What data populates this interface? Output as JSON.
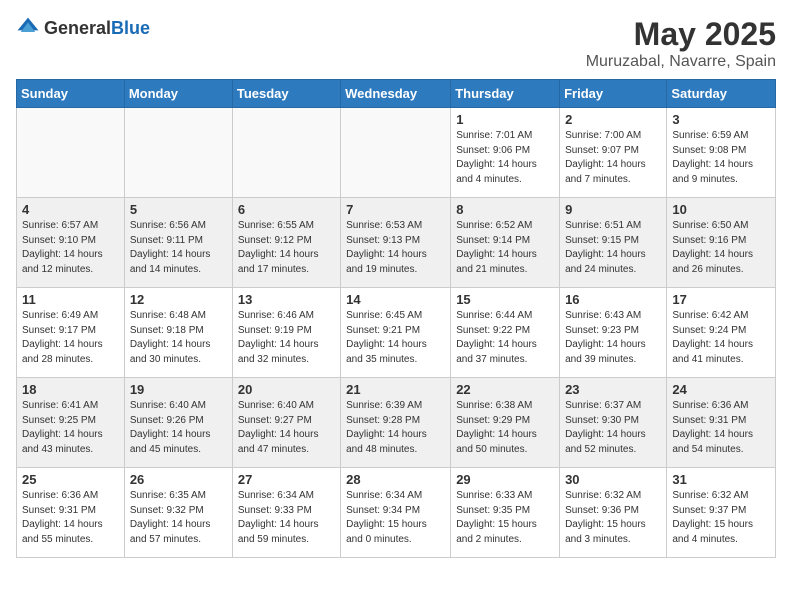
{
  "logo": {
    "general": "General",
    "blue": "Blue"
  },
  "title": "May 2025",
  "location": "Muruzabal, Navarre, Spain",
  "days_of_week": [
    "Sunday",
    "Monday",
    "Tuesday",
    "Wednesday",
    "Thursday",
    "Friday",
    "Saturday"
  ],
  "weeks": [
    [
      {
        "day": "",
        "info": ""
      },
      {
        "day": "",
        "info": ""
      },
      {
        "day": "",
        "info": ""
      },
      {
        "day": "",
        "info": ""
      },
      {
        "day": "1",
        "info": "Sunrise: 7:01 AM\nSunset: 9:06 PM\nDaylight: 14 hours\nand 4 minutes."
      },
      {
        "day": "2",
        "info": "Sunrise: 7:00 AM\nSunset: 9:07 PM\nDaylight: 14 hours\nand 7 minutes."
      },
      {
        "day": "3",
        "info": "Sunrise: 6:59 AM\nSunset: 9:08 PM\nDaylight: 14 hours\nand 9 minutes."
      }
    ],
    [
      {
        "day": "4",
        "info": "Sunrise: 6:57 AM\nSunset: 9:10 PM\nDaylight: 14 hours\nand 12 minutes."
      },
      {
        "day": "5",
        "info": "Sunrise: 6:56 AM\nSunset: 9:11 PM\nDaylight: 14 hours\nand 14 minutes."
      },
      {
        "day": "6",
        "info": "Sunrise: 6:55 AM\nSunset: 9:12 PM\nDaylight: 14 hours\nand 17 minutes."
      },
      {
        "day": "7",
        "info": "Sunrise: 6:53 AM\nSunset: 9:13 PM\nDaylight: 14 hours\nand 19 minutes."
      },
      {
        "day": "8",
        "info": "Sunrise: 6:52 AM\nSunset: 9:14 PM\nDaylight: 14 hours\nand 21 minutes."
      },
      {
        "day": "9",
        "info": "Sunrise: 6:51 AM\nSunset: 9:15 PM\nDaylight: 14 hours\nand 24 minutes."
      },
      {
        "day": "10",
        "info": "Sunrise: 6:50 AM\nSunset: 9:16 PM\nDaylight: 14 hours\nand 26 minutes."
      }
    ],
    [
      {
        "day": "11",
        "info": "Sunrise: 6:49 AM\nSunset: 9:17 PM\nDaylight: 14 hours\nand 28 minutes."
      },
      {
        "day": "12",
        "info": "Sunrise: 6:48 AM\nSunset: 9:18 PM\nDaylight: 14 hours\nand 30 minutes."
      },
      {
        "day": "13",
        "info": "Sunrise: 6:46 AM\nSunset: 9:19 PM\nDaylight: 14 hours\nand 32 minutes."
      },
      {
        "day": "14",
        "info": "Sunrise: 6:45 AM\nSunset: 9:21 PM\nDaylight: 14 hours\nand 35 minutes."
      },
      {
        "day": "15",
        "info": "Sunrise: 6:44 AM\nSunset: 9:22 PM\nDaylight: 14 hours\nand 37 minutes."
      },
      {
        "day": "16",
        "info": "Sunrise: 6:43 AM\nSunset: 9:23 PM\nDaylight: 14 hours\nand 39 minutes."
      },
      {
        "day": "17",
        "info": "Sunrise: 6:42 AM\nSunset: 9:24 PM\nDaylight: 14 hours\nand 41 minutes."
      }
    ],
    [
      {
        "day": "18",
        "info": "Sunrise: 6:41 AM\nSunset: 9:25 PM\nDaylight: 14 hours\nand 43 minutes."
      },
      {
        "day": "19",
        "info": "Sunrise: 6:40 AM\nSunset: 9:26 PM\nDaylight: 14 hours\nand 45 minutes."
      },
      {
        "day": "20",
        "info": "Sunrise: 6:40 AM\nSunset: 9:27 PM\nDaylight: 14 hours\nand 47 minutes."
      },
      {
        "day": "21",
        "info": "Sunrise: 6:39 AM\nSunset: 9:28 PM\nDaylight: 14 hours\nand 48 minutes."
      },
      {
        "day": "22",
        "info": "Sunrise: 6:38 AM\nSunset: 9:29 PM\nDaylight: 14 hours\nand 50 minutes."
      },
      {
        "day": "23",
        "info": "Sunrise: 6:37 AM\nSunset: 9:30 PM\nDaylight: 14 hours\nand 52 minutes."
      },
      {
        "day": "24",
        "info": "Sunrise: 6:36 AM\nSunset: 9:31 PM\nDaylight: 14 hours\nand 54 minutes."
      }
    ],
    [
      {
        "day": "25",
        "info": "Sunrise: 6:36 AM\nSunset: 9:31 PM\nDaylight: 14 hours\nand 55 minutes."
      },
      {
        "day": "26",
        "info": "Sunrise: 6:35 AM\nSunset: 9:32 PM\nDaylight: 14 hours\nand 57 minutes."
      },
      {
        "day": "27",
        "info": "Sunrise: 6:34 AM\nSunset: 9:33 PM\nDaylight: 14 hours\nand 59 minutes."
      },
      {
        "day": "28",
        "info": "Sunrise: 6:34 AM\nSunset: 9:34 PM\nDaylight: 15 hours\nand 0 minutes."
      },
      {
        "day": "29",
        "info": "Sunrise: 6:33 AM\nSunset: 9:35 PM\nDaylight: 15 hours\nand 2 minutes."
      },
      {
        "day": "30",
        "info": "Sunrise: 6:32 AM\nSunset: 9:36 PM\nDaylight: 15 hours\nand 3 minutes."
      },
      {
        "day": "31",
        "info": "Sunrise: 6:32 AM\nSunset: 9:37 PM\nDaylight: 15 hours\nand 4 minutes."
      }
    ]
  ]
}
